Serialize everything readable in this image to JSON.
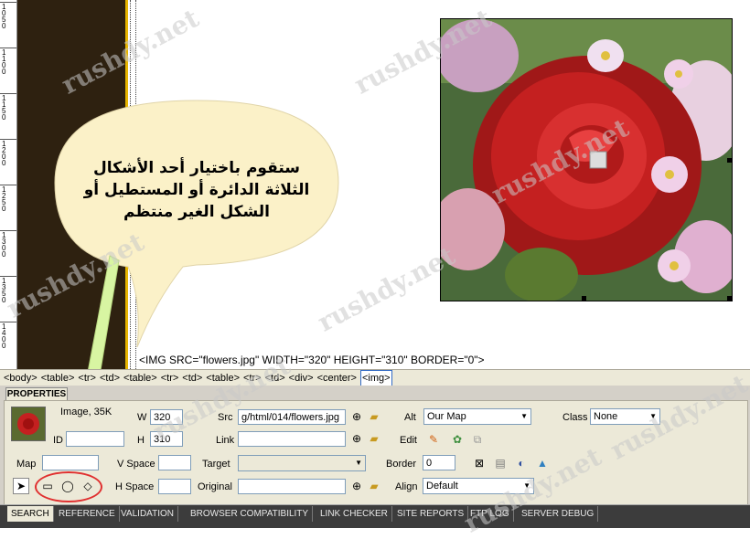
{
  "ruler": {
    "labels": [
      "1050",
      "1100",
      "1150",
      "1200",
      "1250",
      "1300",
      "1350",
      "1400"
    ]
  },
  "image_tag_text": "<IMG SRC=\"flowers.jpg\" WIDTH=\"320\" HEIGHT=\"310\" BORDER=\"0\">",
  "callout": {
    "line1": "ستقوم باختيار أحد الأشكال",
    "line2": "الثلاثة الدائرة أو المستطيل أو",
    "line3": "الشكل الغير منتظم"
  },
  "tag_selector": [
    "<body>",
    "<table>",
    "<tr>",
    "<td>",
    "<table>",
    "<tr>",
    "<td>",
    "<table>",
    "<tr>",
    "<td>",
    "<div>",
    "<center>",
    "<img>"
  ],
  "properties": {
    "tab": "PROPERTIES",
    "image_label": "Image, 35K",
    "w_label": "W",
    "w_value": "320",
    "h_label": "H",
    "h_value": "310",
    "id_label": "ID",
    "id_value": "",
    "src_label": "Src",
    "src_value": "g/html/014/flowers.jpg",
    "link_label": "Link",
    "link_value": "",
    "alt_label": "Alt",
    "alt_value": "Our Map",
    "class_label": "Class",
    "class_value": "None",
    "edit_label": "Edit",
    "map_label": "Map",
    "map_value": "",
    "vspace_label": "V Space",
    "vspace_value": "",
    "hspace_label": "H Space",
    "hspace_value": "",
    "target_label": "Target",
    "target_value": "",
    "original_label": "Original",
    "original_value": "",
    "border_label": "Border",
    "border_value": "0",
    "align_label": "Align",
    "align_value": "Default"
  },
  "bottom_tabs": [
    "SEARCH",
    "REFERENCE",
    "VALIDATION",
    "BROWSER COMPATIBILITY",
    "LINK CHECKER",
    "SITE REPORTS",
    "FTP LOG",
    "SERVER DEBUG"
  ],
  "watermark": "rushdy.net",
  "colors": {
    "dark_column": "#2e2110",
    "gold_line": "#e6b400",
    "bubble_fill": "#fbf1c8",
    "arrow": "#d8f5a2",
    "ellipse": "#e03030"
  }
}
